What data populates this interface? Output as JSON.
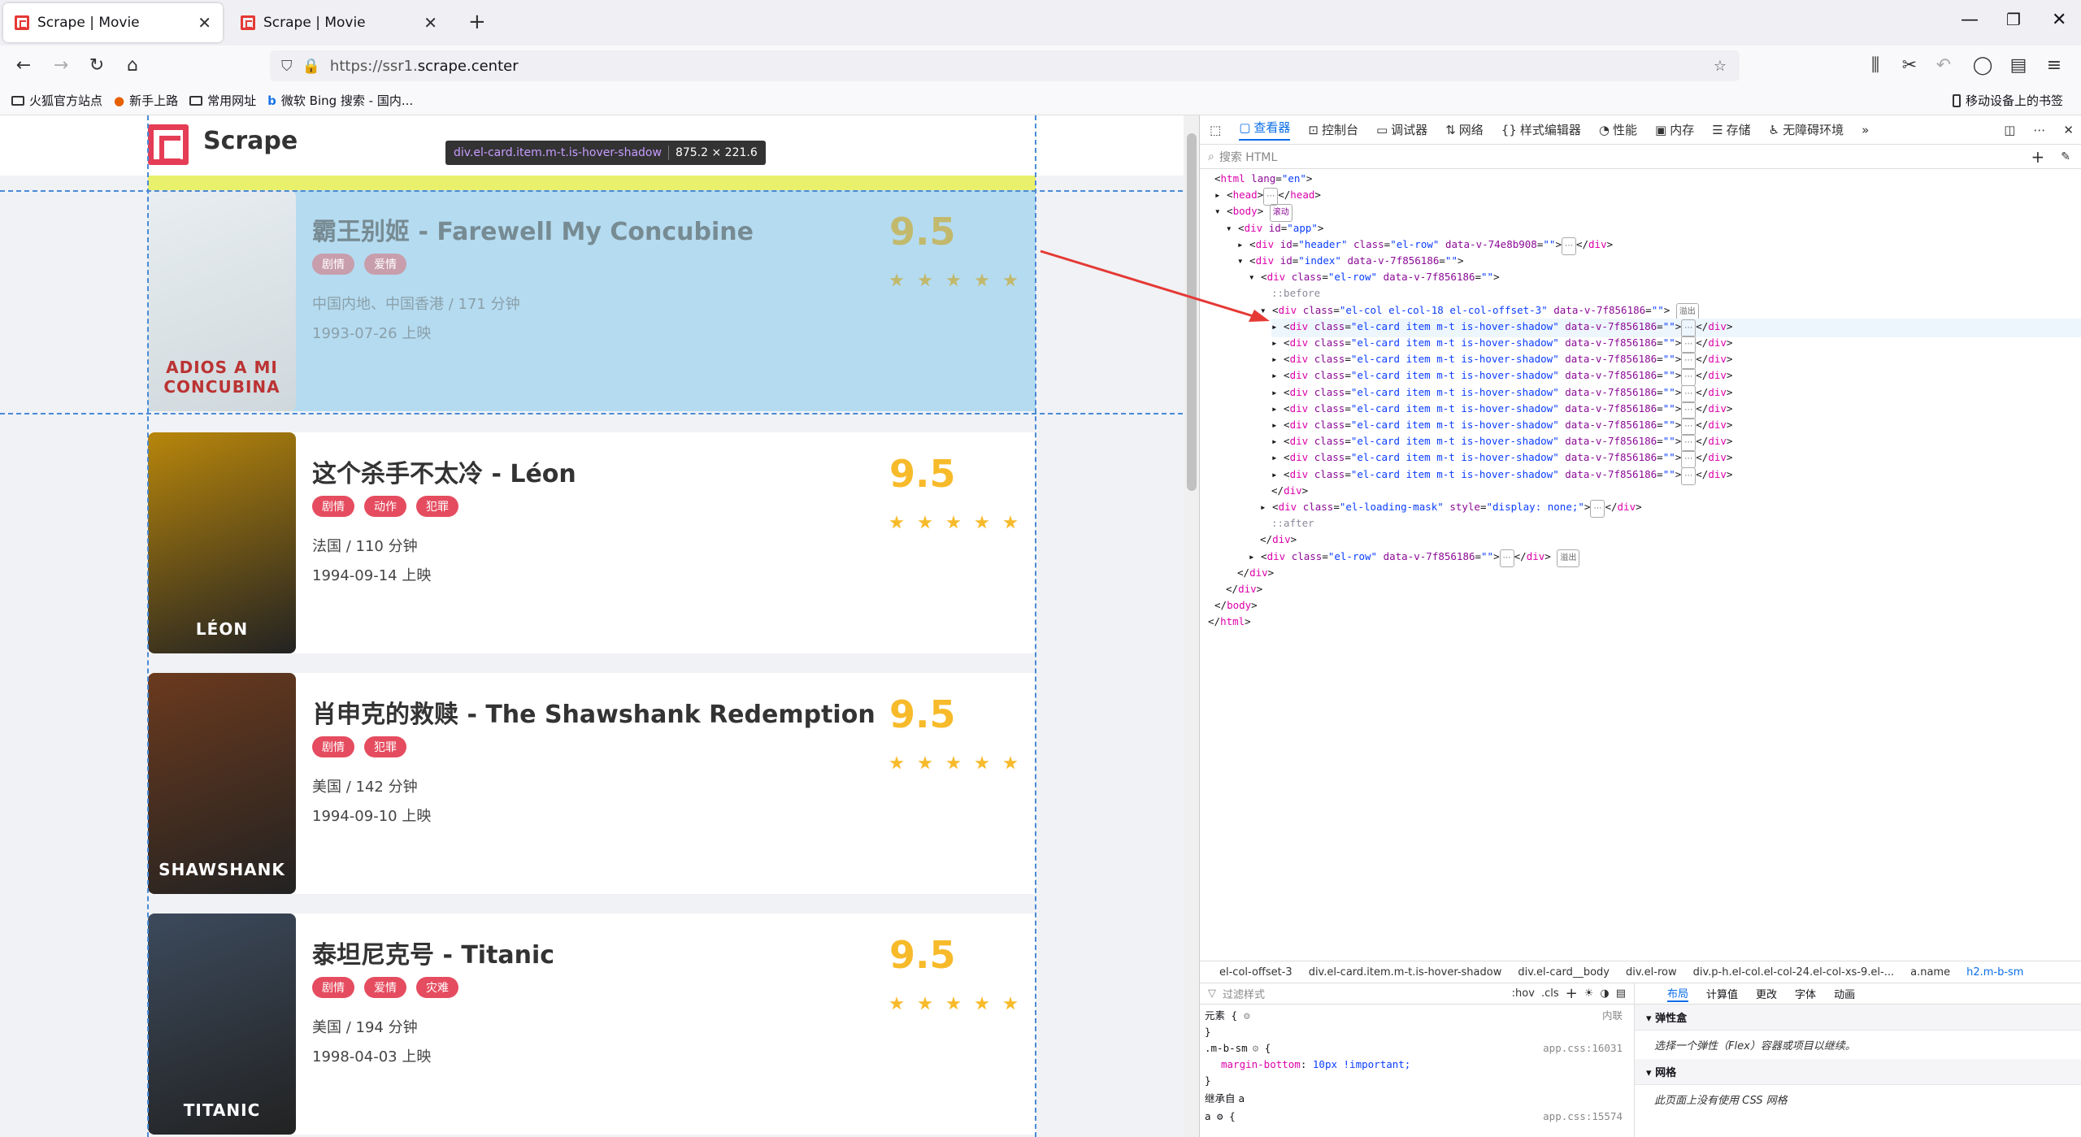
{
  "browser": {
    "tabs": [
      {
        "title": "Scrape | Movie",
        "active": true
      },
      {
        "title": "Scrape | Movie",
        "active": false
      }
    ],
    "url_prefix": "https://ssr1.",
    "url_host": "scrape.center",
    "bookmarks": [
      "火狐官方站点",
      "新手上路",
      "常用网址",
      "微软 Bing 搜索 - 国内...",
      "移动设备上的书签"
    ]
  },
  "page": {
    "brand": "Scrape",
    "tooltip_selector": "div.el-card.item.m-t.is-hover-shadow",
    "tooltip_size": "875.2 × 221.6",
    "movies": [
      {
        "title": "霸王别姬 - Farewell My Concubine",
        "tags": [
          "剧情",
          "爱情"
        ],
        "region": "中国内地、中国香港 / 171 分钟",
        "release": "1993-07-26 上映",
        "score": "9.5",
        "stars": 5,
        "poster_text": "ADIOS A MI CONCUBINA",
        "poster_color": "#cfd8dc",
        "highlighted": true
      },
      {
        "title": "这个杀手不太冷 - Léon",
        "tags": [
          "剧情",
          "动作",
          "犯罪"
        ],
        "region": "法国 / 110 分钟",
        "release": "1994-09-14 上映",
        "score": "9.5",
        "stars": 5,
        "poster_text": "LÉON",
        "poster_color": "#b8860b",
        "highlighted": false
      },
      {
        "title": "肖申克的救赎 - The Shawshank Redemption",
        "tags": [
          "剧情",
          "犯罪"
        ],
        "region": "美国 / 142 分钟",
        "release": "1994-09-10 上映",
        "score": "9.5",
        "stars": 5,
        "poster_text": "SHAWSHANK",
        "poster_color": "#6b3a1e",
        "highlighted": false
      },
      {
        "title": "泰坦尼克号 - Titanic",
        "tags": [
          "剧情",
          "爱情",
          "灾难"
        ],
        "region": "美国 / 194 分钟",
        "release": "1998-04-03 上映",
        "score": "9.5",
        "stars": 5,
        "poster_text": "TITANIC",
        "poster_color": "#3c4a5c",
        "highlighted": false
      }
    ]
  },
  "devtools": {
    "tabs": [
      "查看器",
      "控制台",
      "调试器",
      "网络",
      "样式编辑器",
      "性能",
      "内存",
      "存储",
      "无障碍环境"
    ],
    "search_placeholder": "搜索 HTML",
    "card_count": 10,
    "card_line_class": "el-card item m-t is-hover-shadow",
    "card_line_attr": "data-v-7f856186",
    "breadcrumb": [
      "el-col-offset-3",
      "div.el-card.item.m-t.is-hover-shadow",
      "div.el-card__body",
      "div.el-row",
      "div.p-h.el-col.el-col-24.el-col-xs-9.el-...",
      "a.name",
      "h2.m-b-sm"
    ],
    "filter_placeholder": "过滤样式",
    "filter_buttons": [
      ":hov",
      ".cls"
    ],
    "element_rule": "元素 {",
    "inline_label": "内联",
    "rule_selector": ".m-b-sm",
    "rule_prop": "margin-bottom",
    "rule_value": "10px !important;",
    "rule_source": "app.css:16031",
    "inherited_label": "继承自 a",
    "rule2_source": "app.css:15574",
    "layout_tabs": [
      "布局",
      "计算值",
      "更改",
      "字体",
      "动画"
    ],
    "flex_title": "弹性盒",
    "flex_text": "选择一个弹性（Flex）容器或项目以继续。",
    "grid_title": "网格",
    "grid_text": "此页面上没有使用 CSS 网格"
  }
}
